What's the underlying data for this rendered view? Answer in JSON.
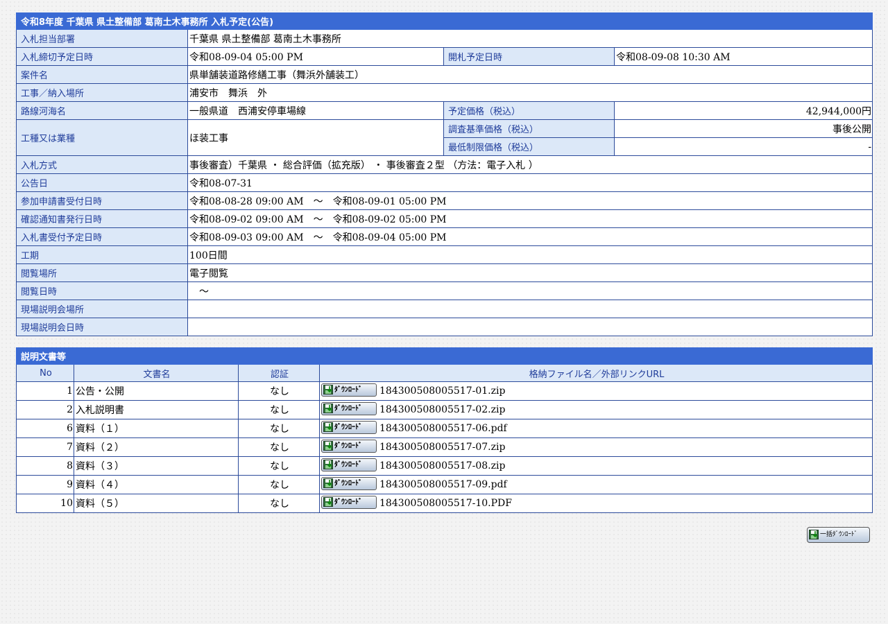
{
  "info": {
    "title": "令和8年度 千葉県 県土整備部 葛南土木事務所 入札予定(公告)",
    "tanto_label": "入札担当部署",
    "tanto_value": "千葉県 県土整備部 葛南土木事務所",
    "shimekiri_label": "入札締切予定日時",
    "shimekiri_value": "令和08-09-04 05:00 PM",
    "kaisatsu_label": "開札予定日時",
    "kaisatsu_value": "令和08-09-08 10:30 AM",
    "anken_label": "案件名",
    "anken_value": "県単舗装道路修繕工事（舞浜外舗装工）",
    "basho_label": "工事／納入場所",
    "basho_value": "浦安市　舞浜　外",
    "rosen_label": "路線河海名",
    "rosen_value": "一般県道　西浦安停車場線",
    "yotei_label": "予定価格（税込）",
    "yotei_value": "42,944,000円",
    "koshu_label": "工種又は業種",
    "koshu_value": "ほ装工事",
    "chosa_label": "調査基準価格（税込）",
    "chosa_value": "事後公開",
    "saitei_label": "最低制限価格（税込）",
    "saitei_value": "-",
    "hoshiki_label": "入札方式",
    "hoshiki_value": "事後審査）千葉県 ・ 総合評価（拡充版） ・ 事後審査２型 （方法：電子入札 ）",
    "kokoku_label": "公告日",
    "kokoku_value": "令和08-07-31",
    "sanka_label": "参加申請書受付日時",
    "sanka_value": "令和08-08-28 09:00 AM　～　令和08-09-01 05:00 PM",
    "kakunin_label": "確認通知書発行日時",
    "kakunin_value": "令和08-09-02 09:00 AM　～　令和08-09-02 05:00 PM",
    "nyusatsusho_label": "入札書受付予定日時",
    "nyusatsusho_value": "令和08-09-03 09:00 AM　～　令和08-09-04 05:00 PM",
    "koki_label": "工期",
    "koki_value": "100日間",
    "etsuran_basho_label": "閲覧場所",
    "etsuran_basho_value": "電子閲覧",
    "etsuran_nichiji_label": "閲覧日時",
    "etsuran_nichiji_value": "　～",
    "genba_basho_label": "現場説明会場所",
    "genba_basho_value": "",
    "genba_nichiji_label": "現場説明会日時",
    "genba_nichiji_value": ""
  },
  "docs": {
    "title": "説明文書等",
    "headers": {
      "no": "No",
      "name": "文書名",
      "auth": "認証",
      "file": "格納ファイル名／外部リンクURL"
    },
    "download_label": "ﾀﾞｳﾝﾛｰﾄﾞ",
    "rows": [
      {
        "no": "1",
        "name": "公告・公開",
        "auth": "なし",
        "file": "184300508005517-01.zip"
      },
      {
        "no": "2",
        "name": "入札説明書",
        "auth": "なし",
        "file": "184300508005517-02.zip"
      },
      {
        "no": "6",
        "name": "資料（１）",
        "auth": "なし",
        "file": "184300508005517-06.pdf"
      },
      {
        "no": "7",
        "name": "資料（２）",
        "auth": "なし",
        "file": "184300508005517-07.zip"
      },
      {
        "no": "8",
        "name": "資料（３）",
        "auth": "なし",
        "file": "184300508005517-08.zip"
      },
      {
        "no": "9",
        "name": "資料（４）",
        "auth": "なし",
        "file": "184300508005517-09.pdf"
      },
      {
        "no": "10",
        "name": "資料（５）",
        "auth": "なし",
        "file": "184300508005517-10.PDF"
      }
    ]
  },
  "bulk_download_label": "一括ﾀﾞｳﾝﾛｰﾄﾞ",
  "icons": {
    "download": "floppy-download-icon"
  },
  "colors": {
    "header_bg": "#3a6ad4",
    "label_bg": "#dce8f8",
    "label_text": "#1f3c9a",
    "border": "#2b4a9a"
  }
}
